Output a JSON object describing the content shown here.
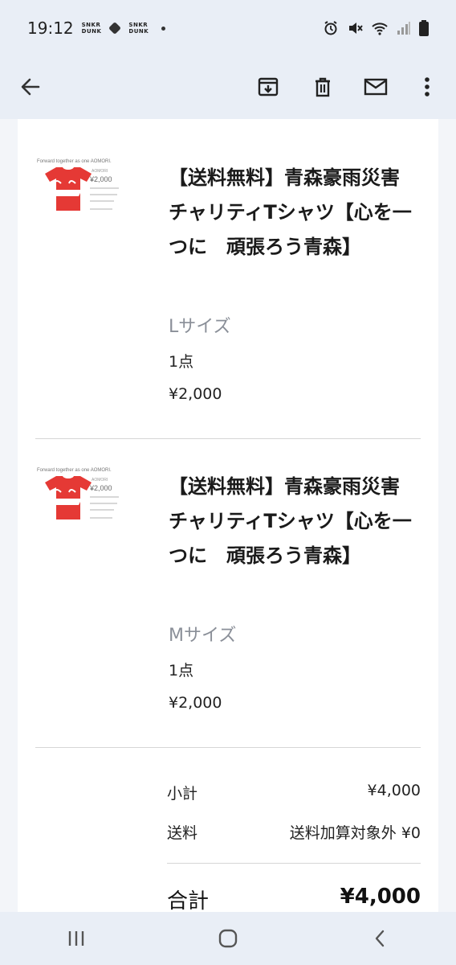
{
  "status_bar": {
    "time": "19:12",
    "app_badge_1": "SNKR\nDUNK",
    "app_badge_2": "SNKR\nDUNK",
    "icons": [
      "alarm-icon",
      "mute-icon",
      "wifi-icon",
      "signal-icon",
      "battery-icon"
    ]
  },
  "toolbar": {
    "back_icon": "arrow-left-icon",
    "archive_icon": "archive-icon",
    "delete_icon": "trash-icon",
    "mail_icon": "mail-icon",
    "more_icon": "more-vert-icon"
  },
  "items": [
    {
      "title": "【送料無料】青森豪雨災害チャリティTシャツ【心を一つに　頑張ろう青森】",
      "size": "Lサイズ",
      "qty": "1点",
      "price": "¥2,000"
    },
    {
      "title": "【送料無料】青森豪雨災害チャリティTシャツ【心を一つに　頑張ろう青森】",
      "size": "Mサイズ",
      "qty": "1点",
      "price": "¥2,000"
    }
  ],
  "thumb": {
    "headline": "Forward together as one AOMORI.",
    "price_text": "¥2,000",
    "shirt_color": "#e53935"
  },
  "summary": {
    "subtotal_label": "小計",
    "subtotal_value": "¥4,000",
    "shipping_label": "送料",
    "shipping_value": "送料加算対象外 ¥0",
    "total_label": "合計",
    "total_value": "¥4,000"
  },
  "colors": {
    "background": "#e9eef6",
    "card": "#ffffff",
    "muted_text": "#8a8f98"
  },
  "nav": {
    "recent_icon": "recent-apps-icon",
    "home_icon": "home-icon",
    "back_icon": "nav-back-icon"
  }
}
